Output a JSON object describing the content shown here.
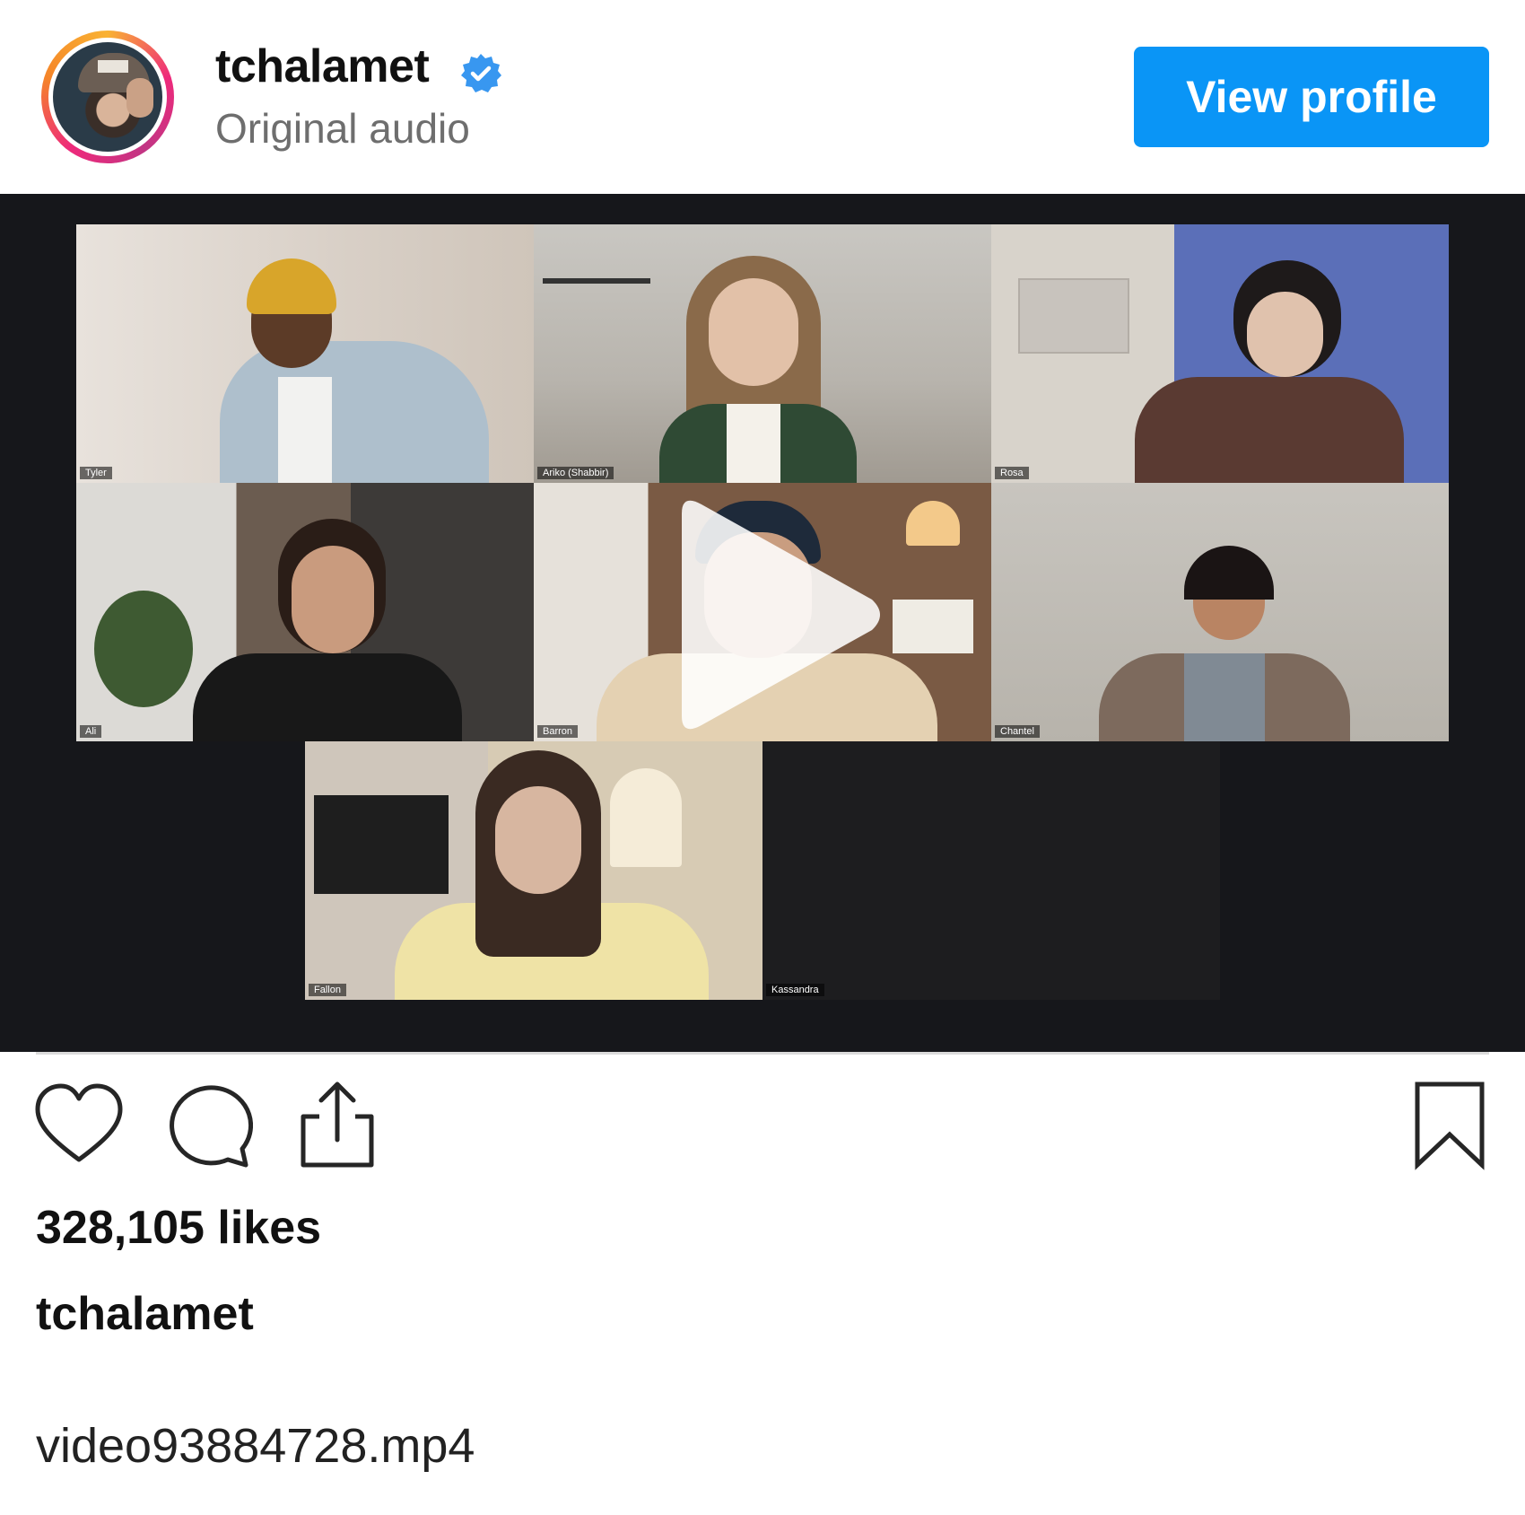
{
  "post": {
    "username": "tchalamet",
    "subtitle": "Original audio",
    "view_profile_label": "View profile",
    "verified": true
  },
  "video": {
    "participants": [
      "Tyler",
      "Ariko (Shabbir)",
      "Rosa",
      "Ali",
      "Barron",
      "Chantel",
      "Fallon",
      "Kassandra"
    ]
  },
  "actions": {
    "like_icon": "heart-icon",
    "comment_icon": "comment-icon",
    "share_icon": "share-icon",
    "save_icon": "bookmark-icon"
  },
  "stats": {
    "likes": "328,105 likes"
  },
  "caption": {
    "username": "tchalamet",
    "text": "video93884728.mp4"
  },
  "colors": {
    "accent": "#0a95f6",
    "video_bg": "#16171b",
    "verified": "#3897f0"
  }
}
